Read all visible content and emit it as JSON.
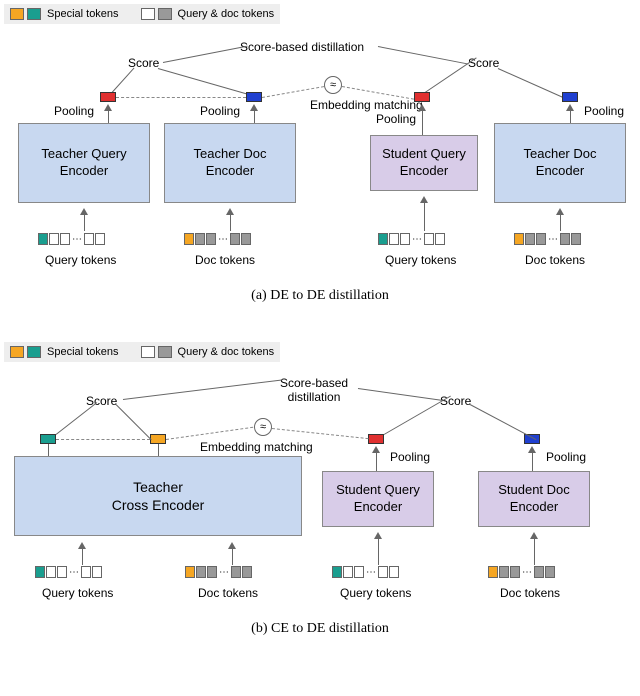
{
  "legend": {
    "special_label": "Special tokens",
    "qd_label": "Query & doc tokens"
  },
  "panel_a": {
    "teacher_query": "Teacher Query\nEncoder",
    "teacher_doc": "Teacher Doc\nEncoder",
    "student_query": "Student Query\nEncoder",
    "score": "Score",
    "pooling": "Pooling",
    "score_distill": "Score-based distillation",
    "emb_match": "Embedding matching",
    "approx": "≈",
    "q_tokens": "Query tokens",
    "d_tokens": "Doc tokens",
    "caption": "(a) DE to DE distillation"
  },
  "panel_b": {
    "teacher_cross": "Teacher\nCross Encoder",
    "student_query": "Student Query\nEncoder",
    "student_doc": "Student Doc\nEncoder",
    "score": "Score",
    "pooling": "Pooling",
    "score_distill": "Score-based\ndistillation",
    "emb_match": "Embedding matching",
    "approx": "≈",
    "q_tokens": "Query tokens",
    "d_tokens": "Doc tokens",
    "caption": "(b) CE to DE distillation"
  }
}
